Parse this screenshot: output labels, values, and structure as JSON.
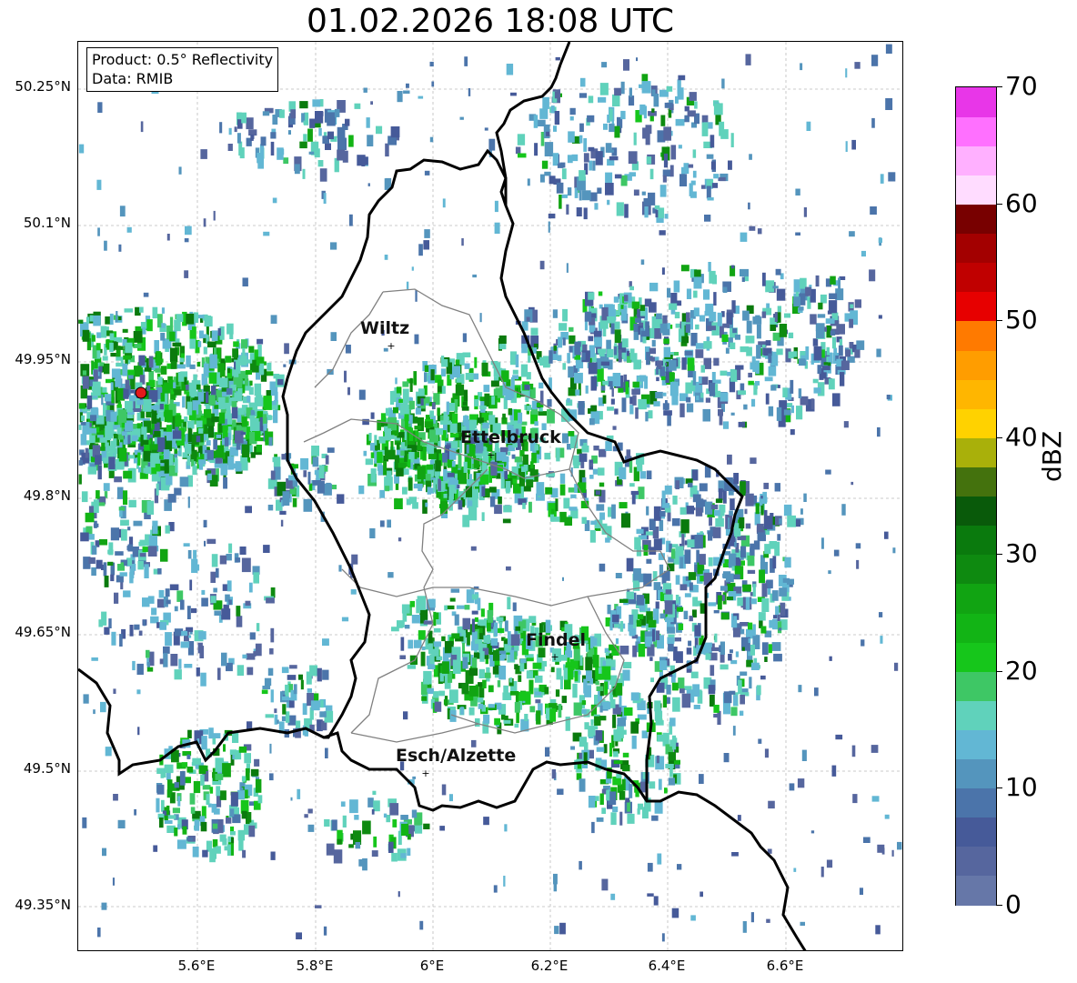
{
  "title": "01.02.2026 18:08 UTC",
  "info": {
    "product": "Product: 0.5° Reflectivity",
    "data": "Data: RMIB"
  },
  "lat_ticks": [
    "50.25°N",
    "50.1°N",
    "49.95°N",
    "49.8°N",
    "49.65°N",
    "49.5°N",
    "49.35°N"
  ],
  "lon_ticks": [
    "5.6°E",
    "5.8°E",
    "6°E",
    "6.2°E",
    "6.4°E",
    "6.6°E"
  ],
  "cities": [
    {
      "name": "Wiltz"
    },
    {
      "name": "Ettelbruck"
    },
    {
      "name": "Findel"
    },
    {
      "name": "Esch/Alzette"
    }
  ],
  "colorbar": {
    "label": "dBZ",
    "ticks": [
      "0",
      "10",
      "20",
      "30",
      "40",
      "50",
      "60",
      "70"
    ],
    "colors": [
      "#6677a8",
      "#56669e",
      "#465a99",
      "#4b74aa",
      "#5495bd",
      "#62b7d4",
      "#60d2bb",
      "#3ec765",
      "#16c61b",
      "#12b415",
      "#11a412",
      "#0e8a10",
      "#0a7a0d",
      "#095a0a",
      "#44720d",
      "#a9b00a",
      "#ffd200",
      "#ffb600",
      "#ff9d00",
      "#ff7a00",
      "#e70000",
      "#c00000",
      "#a30000",
      "#780000",
      "#ffdcff",
      "#ffb0ff",
      "#ff70ff",
      "#e836e8"
    ]
  },
  "colors": {
    "radar_site": "#e31a1c",
    "border": "#000000",
    "canton_lines": "#808080"
  }
}
